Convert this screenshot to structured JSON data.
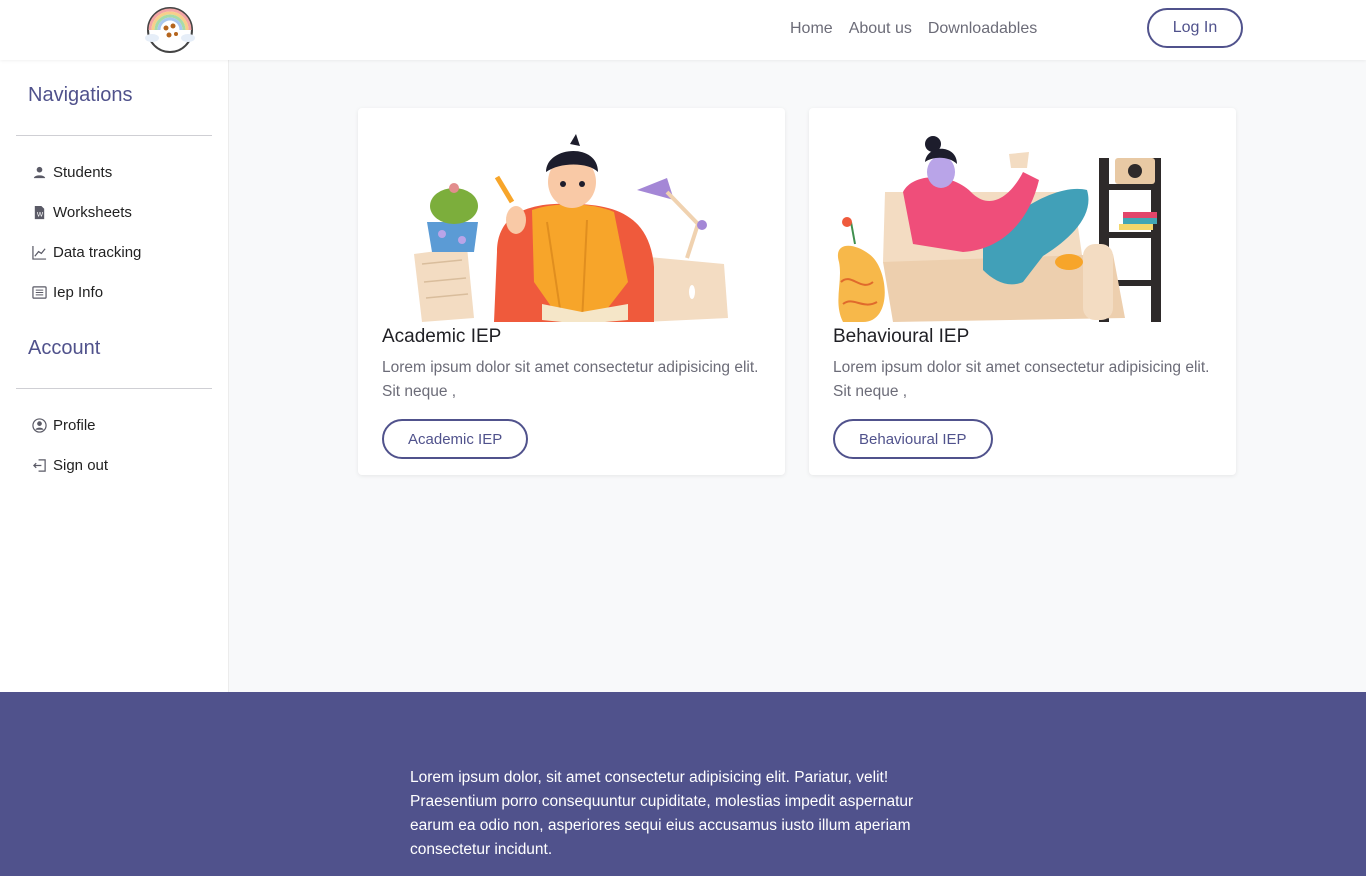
{
  "header": {
    "logo_icon": "rainbow-logo-icon",
    "nav_links": [
      {
        "label": "Home"
      },
      {
        "label": "About us"
      },
      {
        "label": "Downloadables"
      }
    ],
    "login_label": "Log In"
  },
  "sidebar": {
    "navigations_heading": "Navigations",
    "navigation_items": [
      {
        "label": "Students",
        "icon": "person-icon"
      },
      {
        "label": "Worksheets",
        "icon": "word-document-icon"
      },
      {
        "label": "Data tracking",
        "icon": "line-chart-icon"
      },
      {
        "label": "Iep Info",
        "icon": "list-card-icon"
      }
    ],
    "account_heading": "Account",
    "account_items": [
      {
        "label": "Profile",
        "icon": "user-circle-icon"
      },
      {
        "label": "Sign out",
        "icon": "sign-out-icon"
      }
    ]
  },
  "cards": [
    {
      "title": "Academic IEP",
      "text": "Lorem ipsum dolor sit amet consectetur adipisicing elit. Sit neque ,",
      "button_label": "Academic IEP",
      "illustration": "student-studying-illustration"
    },
    {
      "title": "Behavioural IEP",
      "text": "Lorem ipsum dolor sit amet consectetur adipisicing elit. Sit neque ,",
      "button_label": "Behavioural IEP",
      "illustration": "woman-relaxing-on-sofa-illustration"
    }
  ],
  "footer": {
    "text": "Lorem ipsum dolor, sit amet consectetur adipisicing elit. Pariatur, velit! Praesentium porro consequuntur cupiditate, molestias impedit aspernatur earum ea odio non, asperiores sequi eius accusamus iusto illum aperiam consectetur incidunt."
  },
  "colors": {
    "accent": "#50528c",
    "main_background": "#f8f9fa",
    "muted_text": "#6c6c78"
  }
}
